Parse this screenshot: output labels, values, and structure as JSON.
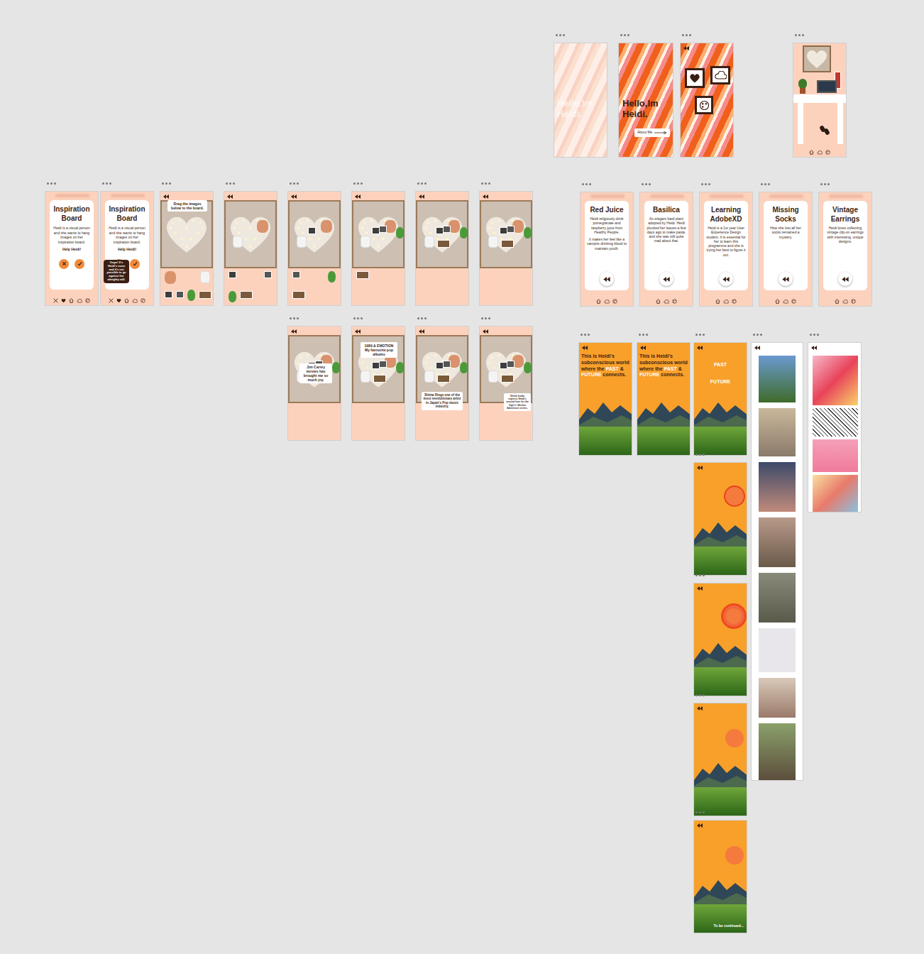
{
  "artboards": [
    {
      "kind": "swirl",
      "variant": "faded",
      "title": "Hello,Im Heidi."
    },
    {
      "kind": "swirl",
      "variant": "hello",
      "title": "Hello,Im Heidi.",
      "button": "About Me"
    },
    {
      "kind": "swirl",
      "variant": "frames"
    },
    {
      "kind": "room"
    },
    {
      "kind": "info",
      "title": "Inspiration Board",
      "body": "Heidi is a visual person and she wants to hang images on her inspiration board.",
      "prompt": "Help Heidi!"
    },
    {
      "kind": "info",
      "title": "Inspiration Board",
      "body": "Heidi is a visual person and she wants to hang images on her inspiration board.",
      "prompt": "Help Heidi!",
      "tooltip": "Oops! It's Heidi's room and it's not possible to go against her almighty will."
    },
    {
      "kind": "board",
      "instruction": "Drag the images below to the board.",
      "placed": 0
    },
    {
      "kind": "board",
      "placed": 2
    },
    {
      "kind": "board",
      "placed": 3
    },
    {
      "kind": "board",
      "placed": 5
    },
    {
      "kind": "board",
      "placed": 6
    },
    {
      "kind": "board",
      "placed": 6
    },
    {
      "kind": "board",
      "placed": 6,
      "caption": [
        "Jim Carrey movies has brought me so much joy."
      ]
    },
    {
      "kind": "board",
      "placed": 6,
      "caption": [
        "1989 & EMOTION",
        "My favourite pop albums"
      ]
    },
    {
      "kind": "board",
      "placed": 6,
      "caption": [
        "Shiina Ringo one of the most revolutionary artist in Japan's Pop music industry."
      ]
    },
    {
      "kind": "board",
      "placed": 6,
      "caption": [
        "Shrek kinda express Heidi's second love for the Ogre's Shrimo Adventure series."
      ]
    },
    {
      "kind": "card",
      "title": "Red Juice",
      "body": [
        "Heidi religiously drink pomegranate and raspberry juice from Healthy People.",
        "It makes her feel like a vampire drinking blood to maintain youth."
      ]
    },
    {
      "kind": "card",
      "title": "Basilica",
      "body": [
        "An elegant basil plant adopted by Heidi. Heidi plucked her leaves a few days ago to make pasta, and she was still quite mad about that."
      ]
    },
    {
      "kind": "card",
      "title": "Learning AdobeXD",
      "body": [
        "Heidi is a 1st year User Experience Design student. It is essential for her to learn this programme and she is trying her best to figure it out."
      ]
    },
    {
      "kind": "card",
      "title": "Missing Socks",
      "body": [
        "How she lost all her socks remained a mystery."
      ]
    },
    {
      "kind": "card",
      "title": "Vintage Earrings",
      "body": [
        "Heidi loves collecting vintage clip-on earrings with interesting, unique designs."
      ]
    },
    {
      "kind": "landscape",
      "caption": [
        {
          "text": "This is Heidi's subconscious world where the ",
          "highlight": false
        },
        {
          "text": "PAST",
          "highlight": true
        },
        {
          "text": " & ",
          "highlight": false
        },
        {
          "text": "FUTURE",
          "highlight": true
        },
        {
          "text": " connects.",
          "highlight": false
        }
      ]
    },
    {
      "kind": "landscape",
      "caption": [
        {
          "text": "This is Heidi's subconscious world where the ",
          "highlight": false
        },
        {
          "text": "PAST",
          "highlight": true
        },
        {
          "text": " & ",
          "highlight": false
        },
        {
          "text": "FUTURE",
          "highlight": true
        },
        {
          "text": " connects.",
          "highlight": false
        }
      ]
    },
    {
      "kind": "landscape",
      "words": [
        "PAST",
        "FUTURE"
      ]
    },
    {
      "kind": "landscape",
      "sun": "ring"
    },
    {
      "kind": "landscape",
      "sun": "glow"
    },
    {
      "kind": "landscape",
      "sun": "plain"
    },
    {
      "kind": "landscape",
      "sun": "plain",
      "ending": "To be continued..."
    },
    {
      "kind": "photos"
    },
    {
      "kind": "illustrations"
    }
  ]
}
